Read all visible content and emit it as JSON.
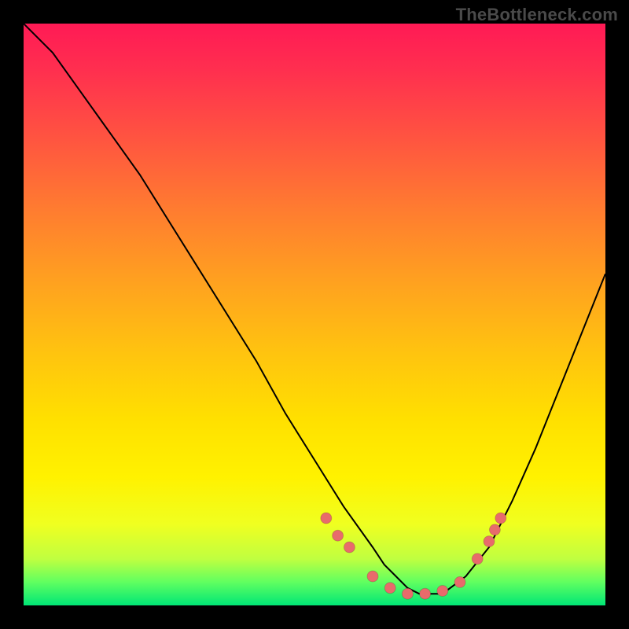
{
  "watermark": "TheBottleneck.com",
  "chart_data": {
    "type": "line",
    "title": "",
    "xlabel": "",
    "ylabel": "",
    "xlim": [
      0,
      100
    ],
    "ylim": [
      0,
      100
    ],
    "grid": false,
    "legend": false,
    "series": [
      {
        "name": "curve",
        "x": [
          0,
          5,
          10,
          15,
          20,
          25,
          30,
          35,
          40,
          45,
          50,
          55,
          60,
          62,
          64,
          66,
          68,
          70,
          72,
          76,
          80,
          84,
          88,
          92,
          96,
          100
        ],
        "y": [
          100,
          95,
          88,
          81,
          74,
          66,
          58,
          50,
          42,
          33,
          25,
          17,
          10,
          7,
          5,
          3,
          2,
          2,
          2,
          5,
          10,
          18,
          27,
          37,
          47,
          57
        ]
      }
    ],
    "markers": [
      {
        "x": 52,
        "y": 15
      },
      {
        "x": 54,
        "y": 12
      },
      {
        "x": 56,
        "y": 10
      },
      {
        "x": 60,
        "y": 5
      },
      {
        "x": 63,
        "y": 3
      },
      {
        "x": 66,
        "y": 2
      },
      {
        "x": 69,
        "y": 2
      },
      {
        "x": 72,
        "y": 2.5
      },
      {
        "x": 75,
        "y": 4
      },
      {
        "x": 78,
        "y": 8
      },
      {
        "x": 80,
        "y": 11
      },
      {
        "x": 81,
        "y": 13
      },
      {
        "x": 82,
        "y": 15
      }
    ]
  }
}
